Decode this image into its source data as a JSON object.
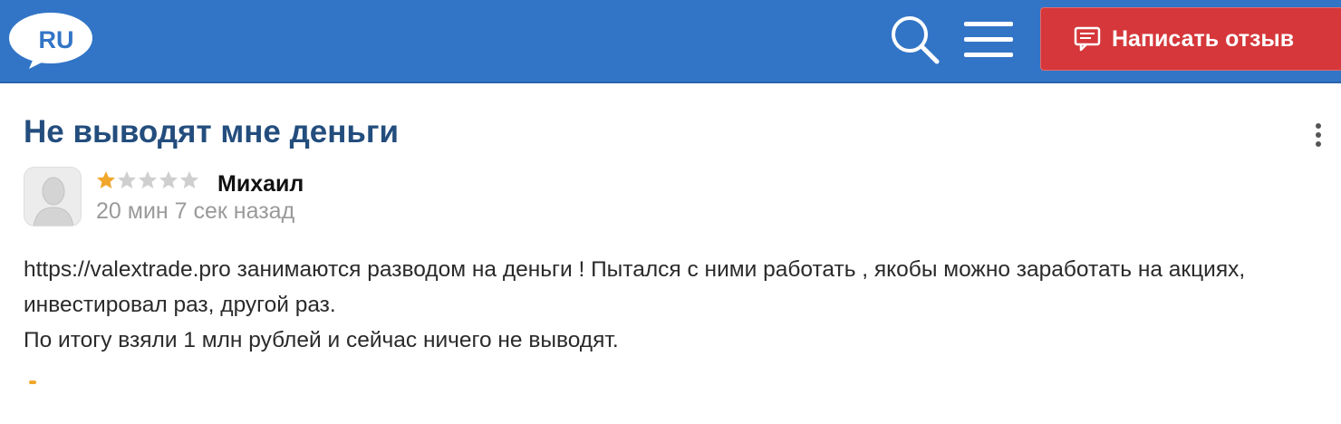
{
  "header": {
    "logo_text": "RU",
    "icons": [
      "speech-bubble-logo",
      "search-icon",
      "hamburger-menu-icon",
      "message-icon"
    ],
    "write_review_label": "Написать отзыв",
    "colors": {
      "bar": "#3275c6",
      "button": "#d5373a"
    }
  },
  "review": {
    "title": "Не выводят мне деньги",
    "rating": 1,
    "rating_max": 5,
    "author": "Михаил",
    "time": "20 мин 7 сек назад",
    "body": [
      "https://valextrade.pro занимаются разводом на деньги ! Пытался с ними работать , якобы можно заработать на акциях, инвестировал раз, другой раз.",
      "По итогу взяли 1 млн рублей и сейчас ничего не выводят."
    ],
    "colors": {
      "title": "#234d7d",
      "star_on": "#f0a72c",
      "star_off": "#cfcfcf"
    }
  }
}
